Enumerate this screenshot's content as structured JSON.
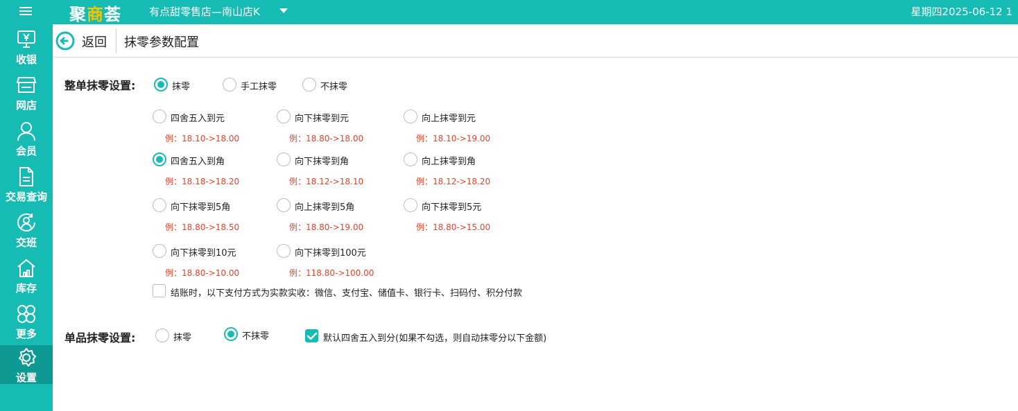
{
  "topbar": {
    "logo_main": "聚",
    "logo_accent": "商",
    "logo_end": "荟",
    "store_name": "有点甜零售店—南山店K",
    "datetime": "星期四2025-06-12 1"
  },
  "sidebar": {
    "items": [
      {
        "label": "收银",
        "icon": "cashier-icon"
      },
      {
        "label": "网店",
        "icon": "shop-icon"
      },
      {
        "label": "会员",
        "icon": "member-icon"
      },
      {
        "label": "交易查询",
        "icon": "document-icon"
      },
      {
        "label": "交班",
        "icon": "shift-icon"
      },
      {
        "label": "库存",
        "icon": "warehouse-icon"
      },
      {
        "label": "更多",
        "icon": "more-icon"
      },
      {
        "label": "设置",
        "icon": "gear-icon"
      }
    ]
  },
  "header": {
    "back_label": "返回",
    "title": "抹零参数配置"
  },
  "order_rounding": {
    "label": "整单抹零设置:",
    "mode_options": [
      "抹零",
      "手工抹零",
      "不抹零"
    ],
    "mode_selected": "抹零",
    "methods": [
      {
        "label": "四舍五入到元",
        "example": "例：18.10->18.00"
      },
      {
        "label": "向下抹零到元",
        "example": "例：18.80->18.00"
      },
      {
        "label": "向上抹零到元",
        "example": "例：18.10->19.00"
      },
      {
        "label": "四舍五入到角",
        "example": "例：18.18->18.20"
      },
      {
        "label": "向下抹零到角",
        "example": "例：18.12->18.10"
      },
      {
        "label": "向上抹零到角",
        "example": "例：18.12->18.20"
      },
      {
        "label": "向下抹零到5角",
        "example": "例：18.80->18.50"
      },
      {
        "label": "向上抹零到5角",
        "example": "例：18.80->19.00"
      },
      {
        "label": "向下抹零到5元",
        "example": "例：18.80->15.00"
      },
      {
        "label": "向下抹零到10元",
        "example": "例：18.80->10.00"
      },
      {
        "label": "向下抹零到100元",
        "example": "例：118.80->100.00"
      }
    ],
    "method_selected": "四舍五入到角",
    "payment_checkbox": "结账时，以下支付方式为实款实收：微信、支付宝、储值卡、银行卡、扫码付、积分付款",
    "payment_checked": false
  },
  "item_rounding": {
    "label": "单品抹零设置:",
    "options": [
      "抹零",
      "不抹零"
    ],
    "selected": "不抹零",
    "default_checkbox": "默认四舍五入到分(如果不勾选，则自动抹零分以下金额)",
    "default_checked": true
  },
  "colors": {
    "brand": "#16bcb4",
    "example_red": "#e8412c"
  }
}
